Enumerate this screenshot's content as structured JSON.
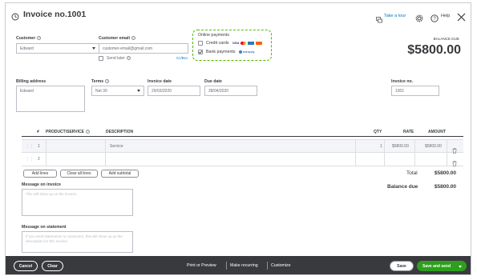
{
  "header": {
    "title": "Invoice no.1001",
    "take_tour": "Take a tour",
    "help": "Help"
  },
  "customer": {
    "label": "Customer",
    "value": "Edward"
  },
  "email": {
    "label": "Customer email",
    "value": "customer-email@gmail.com",
    "send_later": "Send later",
    "cc_bcc": "Cc/Bcc"
  },
  "online_payments": {
    "title": "Online payments",
    "credit_cards": "Credit cards",
    "credit_cards_checked": false,
    "bank_payments": "Bank payments",
    "bank_payments_checked": true,
    "bank_logo": "transpay",
    "card_logos": [
      "VISA",
      "MC",
      "AMEX",
      "DISC"
    ]
  },
  "balance": {
    "label": "BALANCE DUE",
    "amount": "$5800.00"
  },
  "billing": {
    "label": "Billing address",
    "value": "Edward"
  },
  "terms": {
    "label": "Terms",
    "value": "Net 30"
  },
  "invoice_date": {
    "label": "Invoice date",
    "value": "29/03/2020"
  },
  "due_date": {
    "label": "Due date",
    "value": "28/04/2020"
  },
  "invoice_no": {
    "label": "Invoice no.",
    "value": "1001"
  },
  "table": {
    "headers": {
      "num": "#",
      "product": "PRODUCT/SERVICE",
      "description": "DESCRIPTION",
      "qty": "QTY",
      "rate": "RATE",
      "amount": "AMOUNT"
    },
    "rows": [
      {
        "num": "1",
        "product": "",
        "description": "Service",
        "qty": "1",
        "rate": "$5800.00",
        "amount": "$5800.00"
      },
      {
        "num": "2",
        "product": "",
        "description": "",
        "qty": "",
        "rate": "",
        "amount": ""
      }
    ]
  },
  "actions": {
    "add_lines": "Add lines",
    "clear_lines": "Clear all lines",
    "add_subtotal": "Add subtotal"
  },
  "totals": {
    "total_label": "Total",
    "total_value": "$5800.00",
    "balance_due_label": "Balance due",
    "balance_due_value": "$5800.00"
  },
  "message_invoice": {
    "label": "Message on invoice",
    "placeholder": "This will show up on the invoice."
  },
  "message_statement": {
    "label": "Message on statement",
    "placeholder": "If you send statements to customers, this will show up as the description for this invoice."
  },
  "footer": {
    "cancel": "Cancel",
    "clear": "Clear",
    "print": "Print or Preview",
    "recurring": "Make recurring",
    "customize": "Customize",
    "save": "Save",
    "save_send": "Save and send"
  },
  "colors": {
    "accent_green": "#2ca01c",
    "link_blue": "#0077c5",
    "footer_bg": "#393a3d",
    "highlight_dash": "#53b700"
  }
}
